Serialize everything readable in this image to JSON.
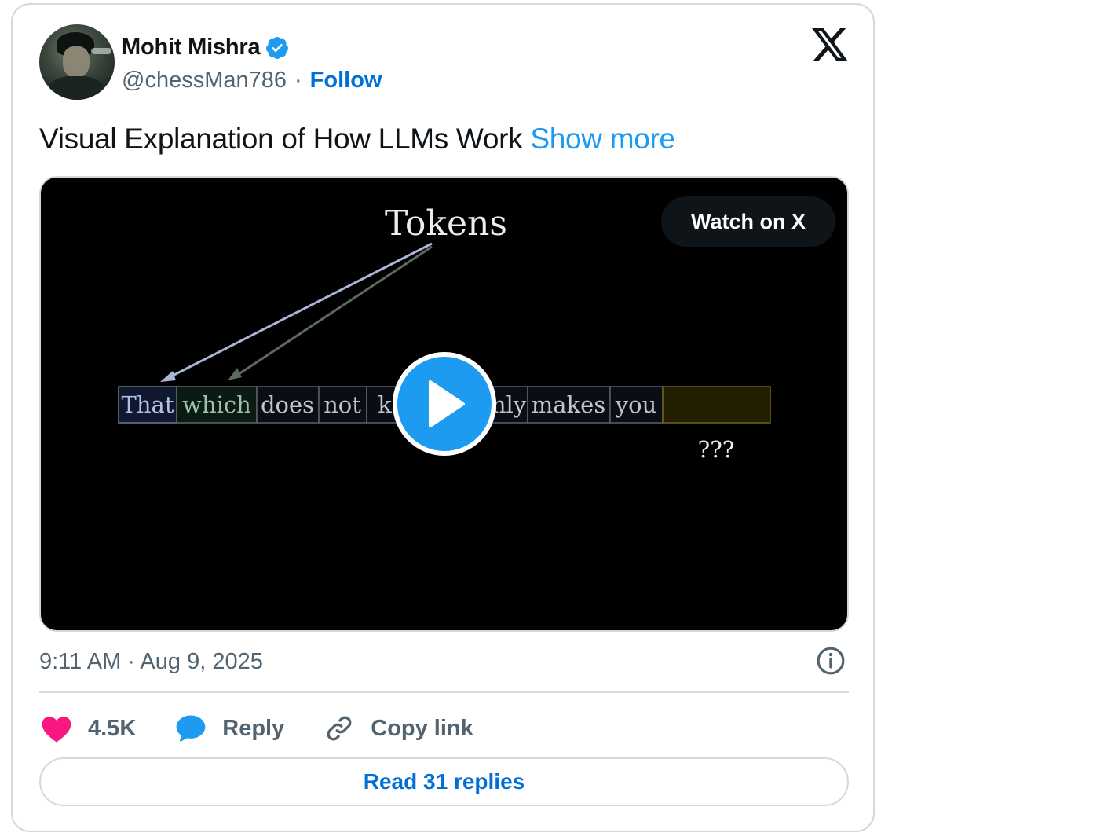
{
  "author": {
    "name": "Mohit Mishra",
    "handle": "@chessMan786",
    "separator": "·",
    "follow_label": "Follow",
    "verified_color": "#1d9bf0"
  },
  "brand": {
    "icon": "x-logo-icon"
  },
  "tweet": {
    "text": "Visual Explanation of How LLMs Work",
    "show_more_label": "Show more"
  },
  "media": {
    "watch_label": "Watch on X",
    "play_icon": "play-icon",
    "video_frame": {
      "title": "Tokens",
      "tokens": [
        "That",
        "which",
        "does",
        "not",
        "k",
        "nly",
        "makes",
        "you"
      ],
      "unknown_label": "???"
    }
  },
  "meta": {
    "timestamp": "9:11 AM · Aug 9, 2025",
    "info_icon": "info-icon"
  },
  "actions": {
    "like_count": "4.5K",
    "reply_label": "Reply",
    "copy_label": "Copy link"
  },
  "read_replies_label": "Read 31 replies",
  "colors": {
    "like": "#f91880",
    "accent": "#1d9bf0",
    "link": "#006fd6",
    "muted": "#536471",
    "border": "#cfd9de"
  }
}
